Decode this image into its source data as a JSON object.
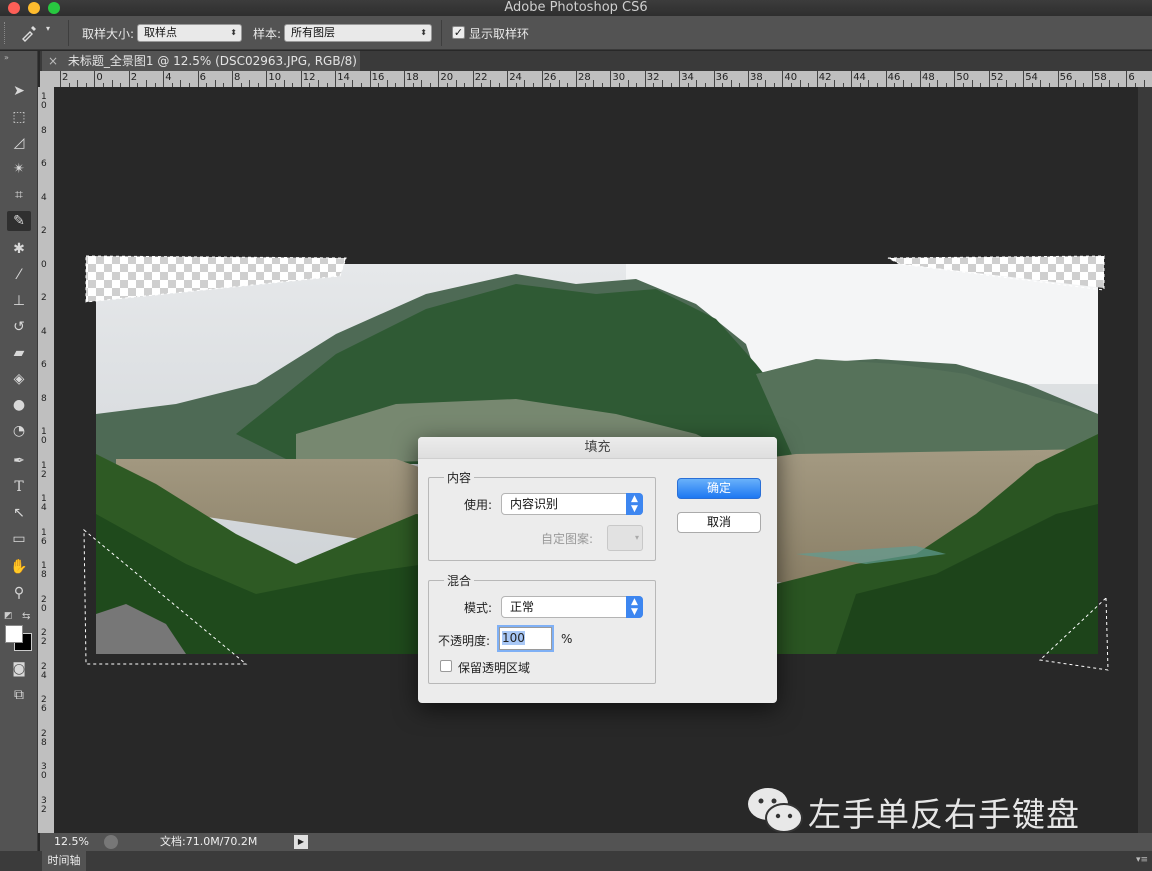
{
  "window": {
    "title": "Adobe Photoshop CS6"
  },
  "options_bar": {
    "sample_size_label": "取样大小:",
    "sample_size_value": "取样点",
    "sample_label": "样本:",
    "sample_value": "所有图层",
    "show_ring_label": "显示取样环",
    "show_ring_checked": true
  },
  "document_tab": {
    "close": "×",
    "title": "未标题_全景图1 @ 12.5% (DSC02963.JPG, RGB/8) *"
  },
  "rulers": {
    "horizontal": [
      "2",
      "0",
      "2",
      "4",
      "6",
      "8",
      "10",
      "12",
      "14",
      "16",
      "18",
      "20",
      "22",
      "24",
      "26",
      "28",
      "30",
      "32",
      "34",
      "36",
      "38",
      "40",
      "42",
      "44",
      "46",
      "48",
      "50",
      "52",
      "54",
      "56",
      "58",
      "6"
    ],
    "vertical": [
      "1\n0",
      "8",
      "6",
      "4",
      "2",
      "0",
      "2",
      "4",
      "6",
      "8",
      "1\n0",
      "1\n2",
      "1\n4",
      "1\n6",
      "1\n8",
      "2\n0",
      "2\n2",
      "2\n4",
      "2\n6",
      "2\n8",
      "3\n0",
      "3\n2"
    ]
  },
  "status_bar": {
    "zoom": "12.5%",
    "doc_info": "文档:71.0M/70.2M"
  },
  "timeline": {
    "label": "时间轴"
  },
  "watermark": {
    "text": "左手单反右手键盘"
  },
  "fill_dialog": {
    "title": "填充",
    "content_group": "内容",
    "use_label": "使用:",
    "use_value": "内容识别",
    "custom_pattern_label": "自定图案:",
    "blend_group": "混合",
    "mode_label": "模式:",
    "mode_value": "正常",
    "opacity_label": "不透明度:",
    "opacity_value": "100",
    "opacity_unit": "%",
    "preserve_transparency_label": "保留透明区域",
    "preserve_transparency_checked": false,
    "ok_label": "确定",
    "cancel_label": "取消"
  },
  "colors": {
    "accent": "#1d77f2",
    "ui_panel": "#535353",
    "canvas": "#282828"
  }
}
